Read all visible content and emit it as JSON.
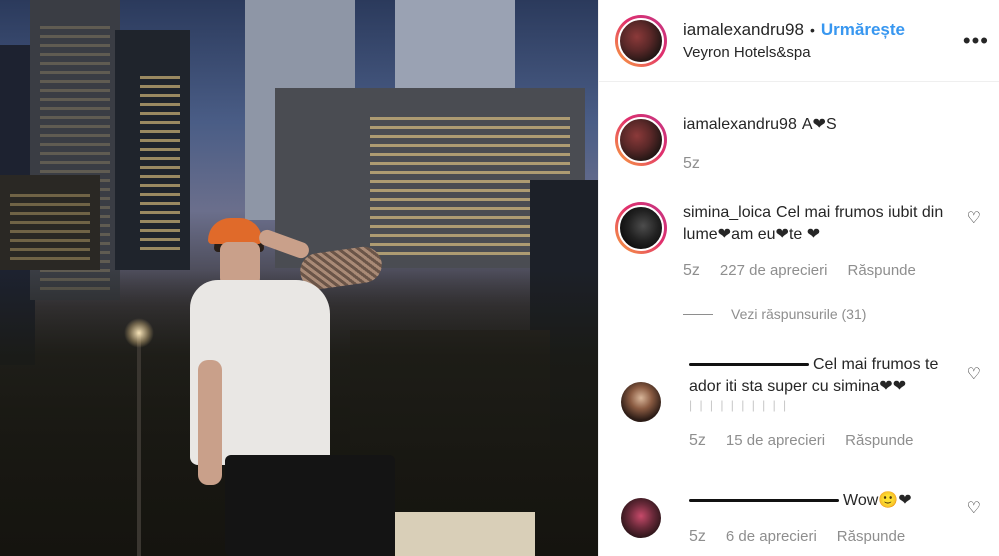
{
  "header": {
    "username": "iamalexandru98",
    "separator": "•",
    "follow_label": "Urmărește",
    "location": "Veyron Hotels&spa",
    "more_label": "•••"
  },
  "caption": {
    "username": "iamalexandru98",
    "text": "A❤S",
    "time": "5z"
  },
  "comments": [
    {
      "username": "simina_loica",
      "text": "Cel mai frumos iubit din lume❤am eu❤te ❤",
      "time": "5z",
      "likes": "227 de aprecieri",
      "reply_label": "Răspunde",
      "view_replies": "Vezi răspunsurile (31)"
    },
    {
      "username_redacted": true,
      "text": "Cel mai frumos te ador iti sta super cu simina❤❤",
      "extra": "| | | | | | | | | |",
      "time": "5z",
      "likes": "15 de aprecieri",
      "reply_label": "Răspunde"
    },
    {
      "username_redacted": true,
      "text": "Wow🙂❤",
      "time": "5z",
      "likes": "6 de aprecieri",
      "reply_label": "Răspunde"
    }
  ],
  "icons": {
    "heart_outline": "♡"
  },
  "colors": {
    "follow": "#3897f0",
    "meta": "#8e8e8e",
    "text": "#262626"
  }
}
